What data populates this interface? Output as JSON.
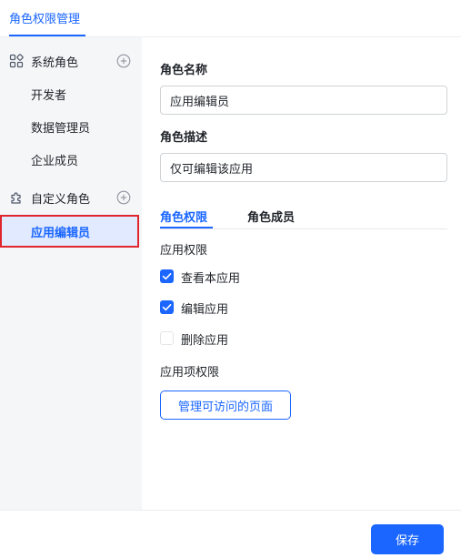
{
  "top_tab": {
    "label": "角色权限管理"
  },
  "sidebar": {
    "groups": [
      {
        "label": "系统角色",
        "icon": "apps-grid-icon",
        "roles": [
          "开发者",
          "数据管理员",
          "企业成员"
        ]
      },
      {
        "label": "自定义角色",
        "icon": "puzzle-icon",
        "roles": [
          "应用编辑员"
        ]
      }
    ],
    "selected_role": "应用编辑员"
  },
  "form": {
    "name_label": "角色名称",
    "name_value": "应用编辑员",
    "desc_label": "角色描述",
    "desc_value": "仅可编辑该应用"
  },
  "tabs": [
    {
      "label": "角色权限",
      "active": true
    },
    {
      "label": "角色成员",
      "active": false
    }
  ],
  "permissions": {
    "app_section_title": "应用权限",
    "items": [
      {
        "label": "查看本应用",
        "checked": true
      },
      {
        "label": "编辑应用",
        "checked": true
      },
      {
        "label": "删除应用",
        "checked": false
      }
    ],
    "item_section_title": "应用项权限",
    "manage_pages_button": "管理可访问的页面"
  },
  "footer": {
    "save_label": "保存"
  },
  "colors": {
    "accent": "#1a66ff",
    "highlight_border": "#e0252c",
    "sidebar_bg": "#f5f6f8"
  }
}
